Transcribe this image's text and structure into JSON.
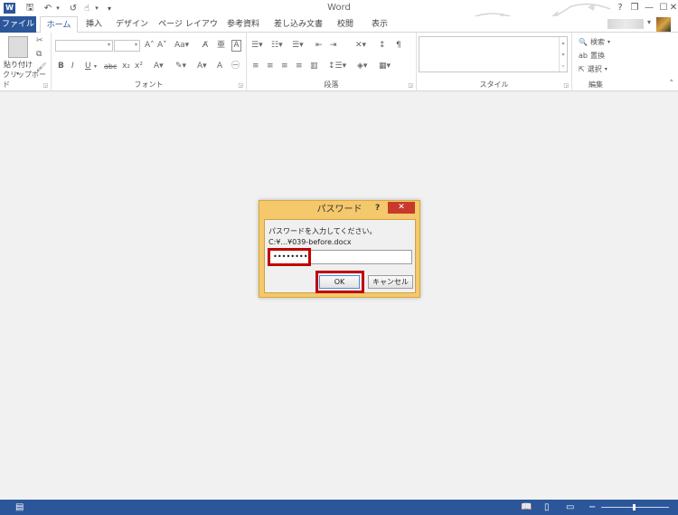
{
  "app": {
    "title": "Word",
    "logo": "W"
  },
  "quick_access": {
    "save_icon": "🖫",
    "undo_icon": "↶",
    "redo_icon": "↺",
    "touch_icon": "☝",
    "customize_icon": "▾"
  },
  "window_controls": {
    "help": "?",
    "restore": "❐",
    "minimize": "—",
    "maximize": "☐",
    "close": "✕"
  },
  "tabs": {
    "file": "ファイル",
    "items": [
      "ホーム",
      "挿入",
      "デザイン",
      "ページ レイアウト",
      "参考資料",
      "差し込み文書",
      "校閲",
      "表示"
    ]
  },
  "ribbon": {
    "clipboard": {
      "paste_label": "貼り付け",
      "group_label": "クリップボード"
    },
    "font": {
      "group_label": "フォント"
    },
    "paragraph": {
      "group_label": "段落"
    },
    "styles": {
      "group_label": "スタイル"
    },
    "editing": {
      "group_label": "編集",
      "find": "検索",
      "replace": "置換",
      "select": "選択"
    }
  },
  "dialog": {
    "title": "パスワード",
    "help": "?",
    "close": "✕",
    "prompt": "パスワードを入力してください。",
    "file_path": "C:¥...¥039-before.docx",
    "password_value": "••••••••",
    "ok_label": "OK",
    "cancel_label": "キャンセル",
    "accent_color": "#c00000"
  },
  "colors": {
    "brand": "#2b579a",
    "dialog_frame": "#f4c86b",
    "close_red": "#c8392c"
  }
}
